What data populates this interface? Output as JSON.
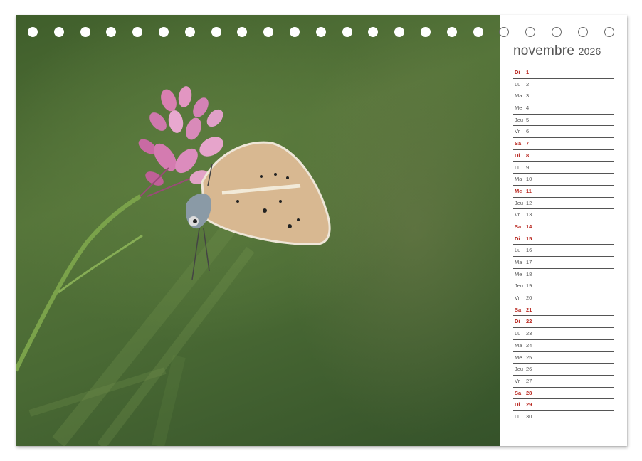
{
  "calendar": {
    "month": "novembre",
    "year": "2026",
    "days": [
      {
        "wd": "Di",
        "num": "1",
        "red": true
      },
      {
        "wd": "Lu",
        "num": "2",
        "red": false
      },
      {
        "wd": "Ma",
        "num": "3",
        "red": false
      },
      {
        "wd": "Me",
        "num": "4",
        "red": false
      },
      {
        "wd": "Jeu",
        "num": "5",
        "red": false
      },
      {
        "wd": "Vr",
        "num": "6",
        "red": false
      },
      {
        "wd": "Sa",
        "num": "7",
        "red": true
      },
      {
        "wd": "Di",
        "num": "8",
        "red": true
      },
      {
        "wd": "Lu",
        "num": "9",
        "red": false
      },
      {
        "wd": "Ma",
        "num": "10",
        "red": false
      },
      {
        "wd": "Me",
        "num": "11",
        "red": true
      },
      {
        "wd": "Jeu",
        "num": "12",
        "red": false
      },
      {
        "wd": "Vr",
        "num": "13",
        "red": false
      },
      {
        "wd": "Sa",
        "num": "14",
        "red": true
      },
      {
        "wd": "Di",
        "num": "15",
        "red": true
      },
      {
        "wd": "Lu",
        "num": "16",
        "red": false
      },
      {
        "wd": "Ma",
        "num": "17",
        "red": false
      },
      {
        "wd": "Me",
        "num": "18",
        "red": false
      },
      {
        "wd": "Jeu",
        "num": "19",
        "red": false
      },
      {
        "wd": "Vr",
        "num": "20",
        "red": false
      },
      {
        "wd": "Sa",
        "num": "21",
        "red": true
      },
      {
        "wd": "Di",
        "num": "22",
        "red": true
      },
      {
        "wd": "Lu",
        "num": "23",
        "red": false
      },
      {
        "wd": "Ma",
        "num": "24",
        "red": false
      },
      {
        "wd": "Me",
        "num": "25",
        "red": false
      },
      {
        "wd": "Jeu",
        "num": "26",
        "red": false
      },
      {
        "wd": "Vr",
        "num": "27",
        "red": false
      },
      {
        "wd": "Sa",
        "num": "28",
        "red": true
      },
      {
        "wd": "Di",
        "num": "29",
        "red": true
      },
      {
        "wd": "Lu",
        "num": "30",
        "red": false
      }
    ]
  },
  "colors": {
    "holiday_red": "#b8261e",
    "text_gray": "#555555",
    "photo_green": "#4a6a34"
  },
  "photo": {
    "subject_icon": "butterfly-on-flower-icon"
  }
}
